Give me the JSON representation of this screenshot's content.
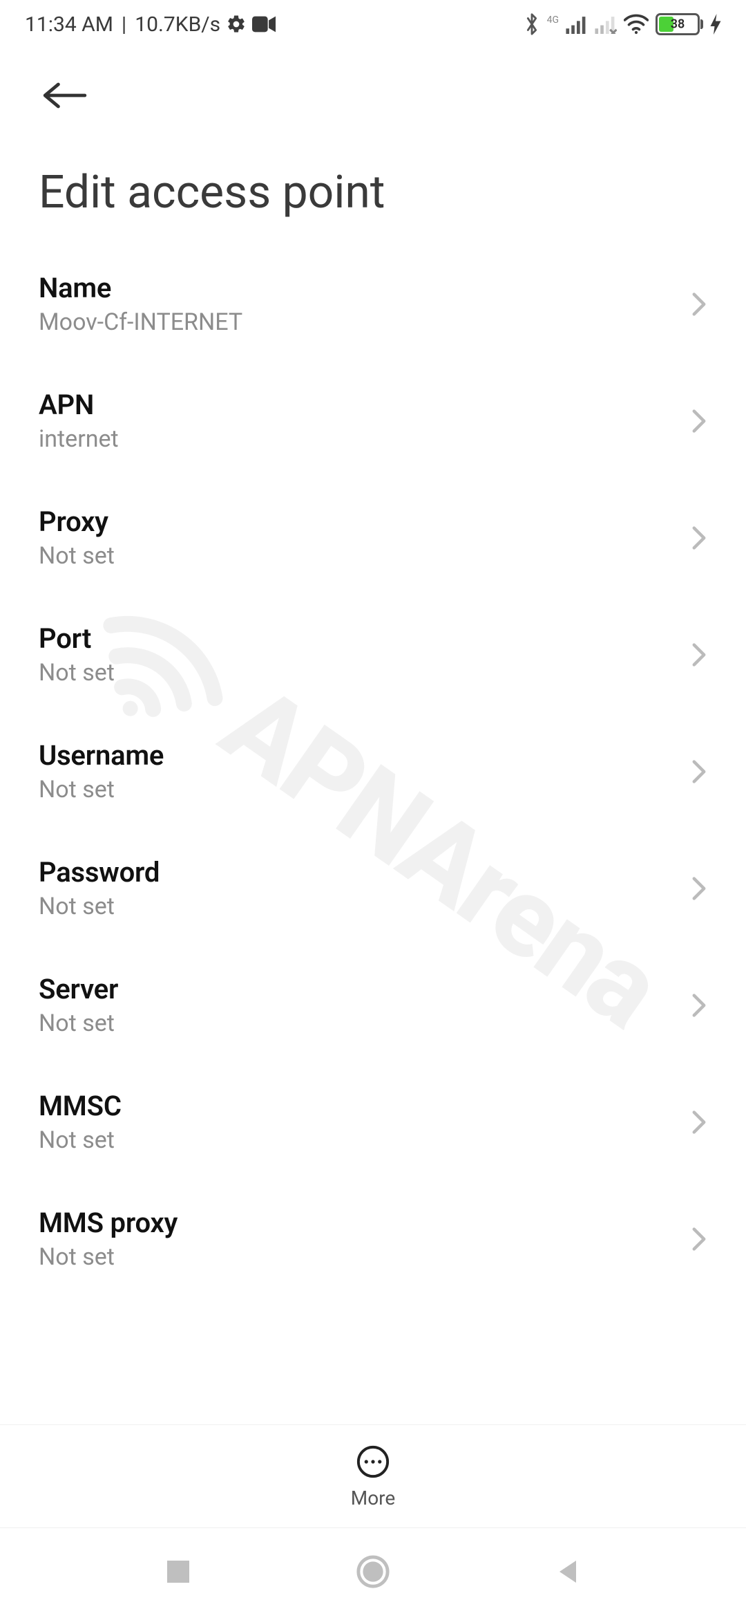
{
  "status": {
    "time": "11:34 AM",
    "net_speed": "10.7KB/s",
    "battery_pct": "38",
    "net_label_4g": "4G"
  },
  "header": {
    "title": "Edit access point"
  },
  "items": [
    {
      "label": "Name",
      "value": "Moov-Cf-INTERNET"
    },
    {
      "label": "APN",
      "value": "internet"
    },
    {
      "label": "Proxy",
      "value": "Not set"
    },
    {
      "label": "Port",
      "value": "Not set"
    },
    {
      "label": "Username",
      "value": "Not set"
    },
    {
      "label": "Password",
      "value": "Not set"
    },
    {
      "label": "Server",
      "value": "Not set"
    },
    {
      "label": "MMSC",
      "value": "Not set"
    },
    {
      "label": "MMS proxy",
      "value": "Not set"
    }
  ],
  "actions": {
    "more_label": "More"
  },
  "watermark": "APNArena"
}
